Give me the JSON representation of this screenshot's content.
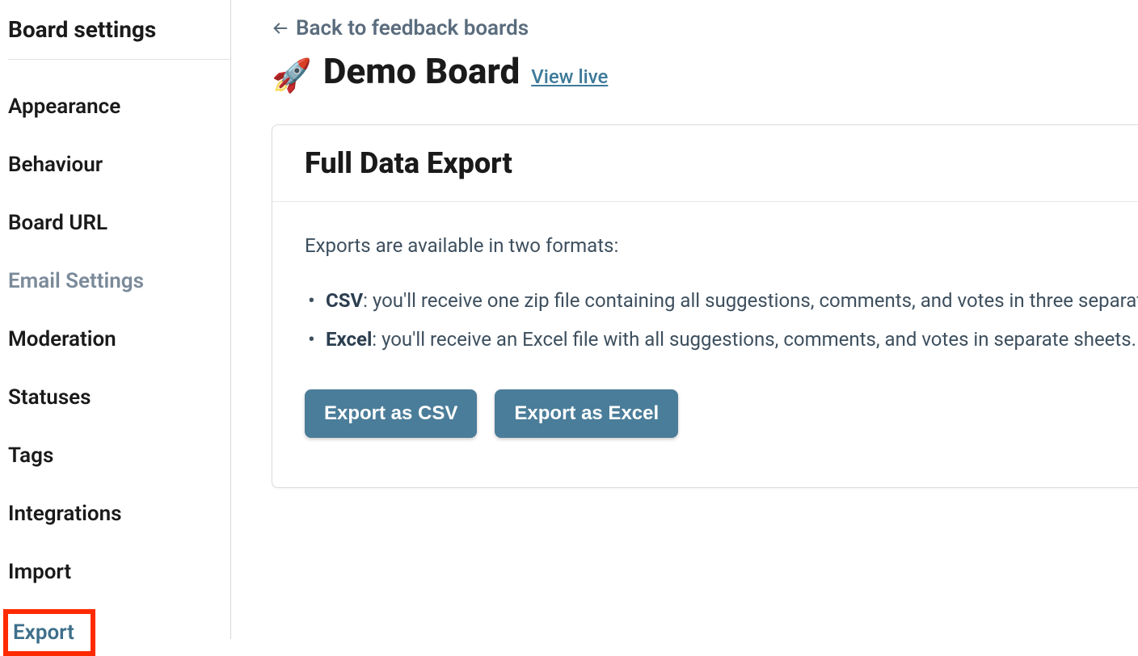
{
  "sidebar": {
    "header": "Board settings",
    "items": [
      {
        "label": "Appearance",
        "muted": false,
        "active": false
      },
      {
        "label": "Behaviour",
        "muted": false,
        "active": false
      },
      {
        "label": "Board URL",
        "muted": false,
        "active": false
      },
      {
        "label": "Email Settings",
        "muted": true,
        "active": false
      },
      {
        "label": "Moderation",
        "muted": false,
        "active": false
      },
      {
        "label": "Statuses",
        "muted": false,
        "active": false
      },
      {
        "label": "Tags",
        "muted": false,
        "active": false
      },
      {
        "label": "Integrations",
        "muted": false,
        "active": false
      },
      {
        "label": "Import",
        "muted": false,
        "active": false
      },
      {
        "label": "Export",
        "muted": false,
        "active": true
      }
    ]
  },
  "header": {
    "back_label": "Back to feedback boards",
    "icon": "🚀",
    "title": "Demo Board",
    "view_live": "View live"
  },
  "card": {
    "title": "Full Data Export",
    "intro": "Exports are available in two formats:",
    "formats": [
      {
        "name": "CSV",
        "desc": ": you'll receive one zip file containing all suggestions, comments, and votes in three separate CSVs."
      },
      {
        "name": "Excel",
        "desc": ": you'll receive an Excel file with all suggestions, comments, and votes in separate sheets."
      }
    ],
    "buttons": {
      "csv": "Export as CSV",
      "excel": "Export as Excel"
    }
  },
  "colors": {
    "accent": "#4a7d99",
    "highlight_border": "#ff2a00"
  }
}
